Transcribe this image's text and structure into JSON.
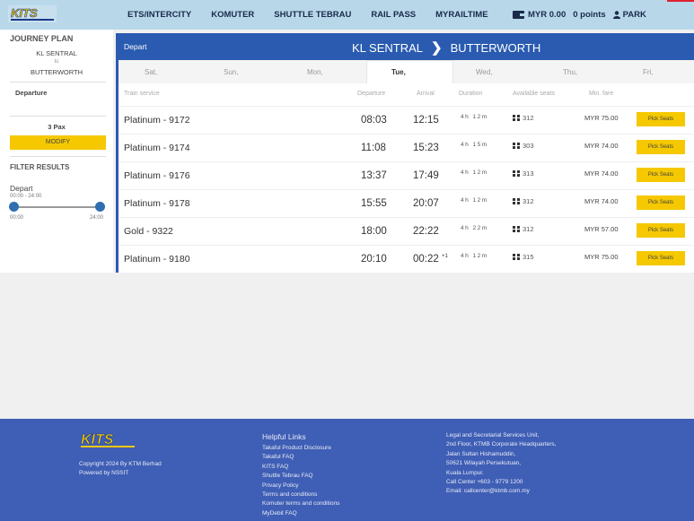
{
  "nav": {
    "items": [
      "ETS/INTERCITY",
      "KOMUTER",
      "SHUTTLE TEBRAU",
      "RAIL PASS",
      "MYRAILTIME"
    ],
    "wallet": "MYR 0.00",
    "points": "0 points",
    "user": "PARK"
  },
  "sidebar": {
    "title": "JOURNEY PLAN",
    "from": "KL SENTRAL",
    "to_label": "to",
    "to": "BUTTERWORTH",
    "departure_label": "Departure",
    "pax": "3 Pax",
    "modify": "MODIFY",
    "filter_title": "FILTER RESULTS",
    "depart_label": "Depart",
    "depart_range": "00:00 - 24:00",
    "slider_min": "00:00",
    "slider_max": "24:00"
  },
  "main": {
    "depart_label": "Depart",
    "origin": "KL SENTRAL",
    "destination": "BUTTERWORTH",
    "days": [
      "Sat,",
      "Sun,",
      "Mon,",
      "Tue,",
      "Wed,",
      "Thu,",
      "Fri,"
    ],
    "active_day": "Tue,",
    "columns": {
      "service": "Train service",
      "departure": "Departure",
      "arrival": "Arrival",
      "duration": "Duration",
      "seats": "Available seats",
      "fare": "Min. fare"
    },
    "pick_label": "Pick Seats",
    "trains": [
      {
        "service": "Platinum - 9172",
        "dep": "08:03",
        "arr": "12:15",
        "arr_sup": "",
        "dur": "4h 12m",
        "seats": "312",
        "fare": "MYR 75.00"
      },
      {
        "service": "Platinum - 9174",
        "dep": "11:08",
        "arr": "15:23",
        "arr_sup": "",
        "dur": "4h 15m",
        "seats": "303",
        "fare": "MYR 74.00"
      },
      {
        "service": "Platinum - 9176",
        "dep": "13:37",
        "arr": "17:49",
        "arr_sup": "",
        "dur": "4h 12m",
        "seats": "313",
        "fare": "MYR 74.00"
      },
      {
        "service": "Platinum - 9178",
        "dep": "15:55",
        "arr": "20:07",
        "arr_sup": "",
        "dur": "4h 12m",
        "seats": "312",
        "fare": "MYR 74.00"
      },
      {
        "service": "Gold - 9322",
        "dep": "18:00",
        "arr": "22:22",
        "arr_sup": "",
        "dur": "4h 22m",
        "seats": "312",
        "fare": "MYR 57.00"
      },
      {
        "service": "Platinum - 9180",
        "dep": "20:10",
        "arr": "00:22",
        "arr_sup": "+1",
        "dur": "4h 12m",
        "seats": "315",
        "fare": "MYR 75.00"
      }
    ]
  },
  "footer": {
    "copyright": "Copyright 2024 By KTM Berhad",
    "powered": "Powered by NSSIT",
    "links_title": "Helpful Links",
    "links": [
      "Takaful Product Disclosure",
      "Takaful FAQ",
      "KITS FAQ",
      "Shuttle Tebrau FAQ",
      "Privacy Policy",
      "Terms and conditions",
      "Komuter terms and conditions",
      "MyDebit FAQ"
    ],
    "contact": [
      "Legal and Secretarial Services Unit,",
      "2nd Floor, KTMB Corporate Headquarters,",
      "Jalan Sultan Hishamuddin,",
      "50621 Wilayah Persekutuan,",
      "Kuala Lumpur.",
      "Call Center +603 - 9779 1200",
      "Email: callcenter@ktmb.com.my"
    ]
  },
  "colors": {
    "brand_blue": "#2a5bb0",
    "accent_yellow": "#f5c800",
    "nav_bg": "#b8d8ea",
    "footer_bg": "#3f5eb5"
  }
}
